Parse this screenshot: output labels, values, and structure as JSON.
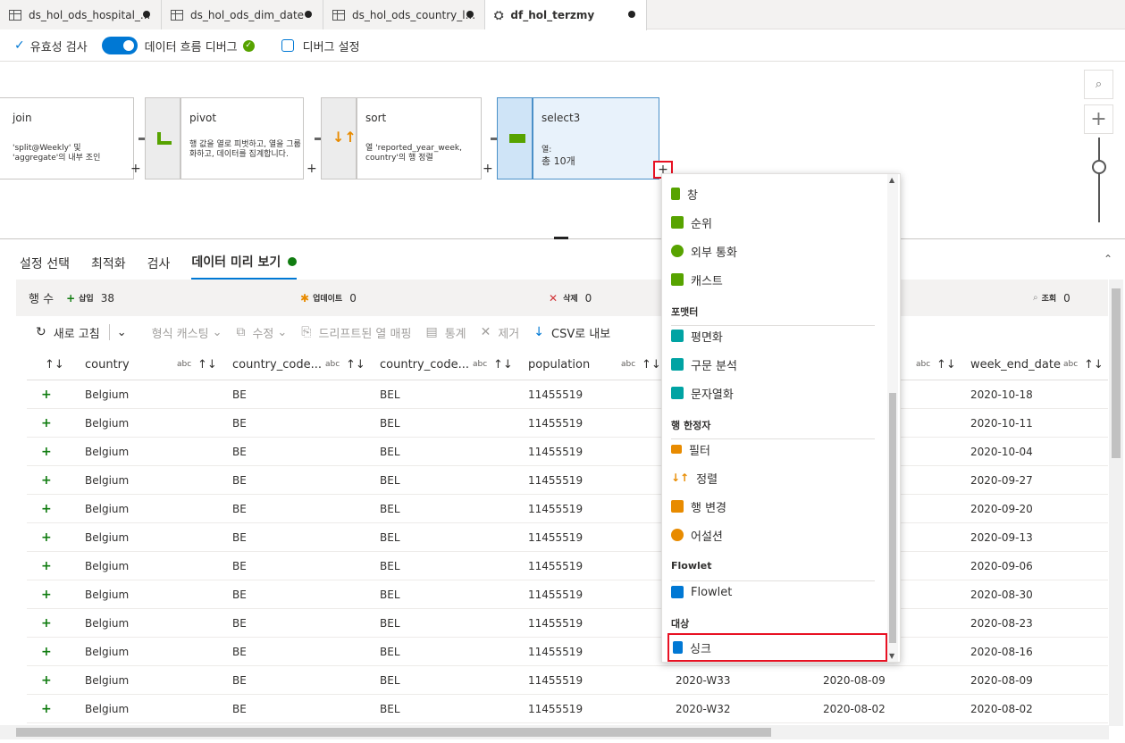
{
  "tabs": [
    {
      "label": "ds_hol_ods_hospital_..."
    },
    {
      "label": "ds_hol_ods_dim_date"
    },
    {
      "label": "ds_hol_ods_country_l..."
    },
    {
      "label": "df_hol_terzmy"
    }
  ],
  "toolbar": {
    "validate": "유효성 검사",
    "debug": "데이터 흐름 디버그",
    "debug_settings": "디버그 설정"
  },
  "nodes": {
    "join": {
      "title": "join",
      "desc": "'split@Weekly' 및 'aggregate'의 내부 조인"
    },
    "pivot": {
      "title": "pivot",
      "desc": "행 값을 열로 피벗하고, 열을 그룹화하고, 데이터를 집계합니다."
    },
    "sort": {
      "title": "sort",
      "desc": "열 'reported_year_week, country'의 행 정렬"
    },
    "select3": {
      "title": "select3",
      "desc_line1": "열:",
      "desc_line2": "총 10개"
    }
  },
  "panel_tabs": [
    "설정 선택",
    "최적화",
    "검사",
    "데이터 미리 보기"
  ],
  "stats": {
    "rows_label": "행 수",
    "insert_label": "삽입",
    "insert_value": "38",
    "update_label": "업데이트",
    "update_value": "0",
    "delete_label": "삭제",
    "delete_value": "0",
    "lookup_label": "조회",
    "lookup_value": "0"
  },
  "actions": {
    "refresh": "새로 고침",
    "typecast": "형식 캐스팅",
    "modify": "수정",
    "map_drifted": "드리프트된 열 매핑",
    "statistics": "통계",
    "remove": "제거",
    "csv": "CSV로 내보"
  },
  "columns": [
    {
      "name": "country"
    },
    {
      "name": "country_code..."
    },
    {
      "name": "country_code..."
    },
    {
      "name": "population"
    },
    {
      "name": ""
    },
    {
      "name": ""
    },
    {
      "name": "week_end_date"
    }
  ],
  "abc": "abc",
  "rows": [
    {
      "c1": "Belgium",
      "c2": "BE",
      "c3": "BEL",
      "c4": "11455519",
      "c5": "",
      "c6": "",
      "c7": "2020-10-18"
    },
    {
      "c1": "Belgium",
      "c2": "BE",
      "c3": "BEL",
      "c4": "11455519",
      "c5": "",
      "c6": "",
      "c7": "2020-10-11"
    },
    {
      "c1": "Belgium",
      "c2": "BE",
      "c3": "BEL",
      "c4": "11455519",
      "c5": "",
      "c6": "",
      "c7": "2020-10-04"
    },
    {
      "c1": "Belgium",
      "c2": "BE",
      "c3": "BEL",
      "c4": "11455519",
      "c5": "",
      "c6": "",
      "c7": "2020-09-27"
    },
    {
      "c1": "Belgium",
      "c2": "BE",
      "c3": "BEL",
      "c4": "11455519",
      "c5": "",
      "c6": "",
      "c7": "2020-09-20"
    },
    {
      "c1": "Belgium",
      "c2": "BE",
      "c3": "BEL",
      "c4": "11455519",
      "c5": "",
      "c6": "",
      "c7": "2020-09-13"
    },
    {
      "c1": "Belgium",
      "c2": "BE",
      "c3": "BEL",
      "c4": "11455519",
      "c5": "",
      "c6": "",
      "c7": "2020-09-06"
    },
    {
      "c1": "Belgium",
      "c2": "BE",
      "c3": "BEL",
      "c4": "11455519",
      "c5": "",
      "c6": "",
      "c7": "2020-08-30"
    },
    {
      "c1": "Belgium",
      "c2": "BE",
      "c3": "BEL",
      "c4": "11455519",
      "c5": "",
      "c6": "",
      "c7": "2020-08-23"
    },
    {
      "c1": "Belgium",
      "c2": "BE",
      "c3": "BEL",
      "c4": "11455519",
      "c5": "",
      "c6": "",
      "c7": "2020-08-16"
    },
    {
      "c1": "Belgium",
      "c2": "BE",
      "c3": "BEL",
      "c4": "11455519",
      "c5": "2020-W33",
      "c6": "2020-08-09",
      "c7": "2020-08-09"
    },
    {
      "c1": "Belgium",
      "c2": "BE",
      "c3": "BEL",
      "c4": "11455519",
      "c5": "2020-W32",
      "c6": "2020-08-02",
      "c7": "2020-08-02"
    }
  ],
  "menu": {
    "items_top": [
      "창",
      "순위",
      "외부 통화",
      "캐스트"
    ],
    "section_formatters": "포맷터",
    "formatters": [
      "평면화",
      "구문 분석",
      "문자열화"
    ],
    "section_row_modifiers": "행 한정자",
    "row_modifiers": [
      "필터",
      "정렬",
      "행 변경",
      "어설션"
    ],
    "section_flowlet": "Flowlet",
    "flowlet": "Flowlet",
    "section_destination": "대상",
    "sink": "싱크"
  },
  "colors": {
    "accent": "#0078d4",
    "insert_green": "#107c10",
    "highlight_red": "#e81123"
  }
}
